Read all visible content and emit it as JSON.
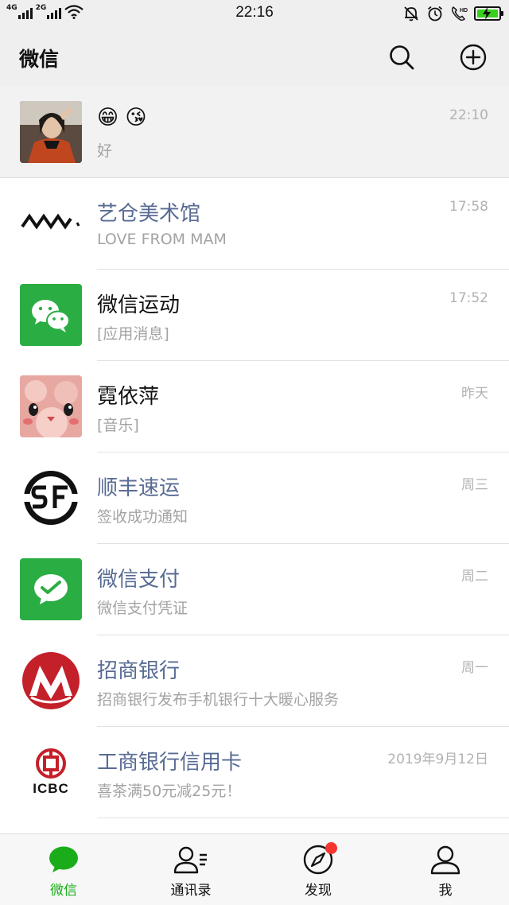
{
  "status_bar": {
    "network1": "4G",
    "network2": "2G",
    "time": "22:16",
    "battery_color": "#39d11f"
  },
  "header": {
    "title": "微信",
    "search_icon": "search-icon",
    "add_icon": "plus-circle-icon"
  },
  "chats": [
    {
      "name": "😁 😘",
      "preview": "好",
      "time": "22:10",
      "pinned": true,
      "avatar": "photo-avatar"
    },
    {
      "name": "艺仓美术馆",
      "preview": "LOVE FROM MAM",
      "time": "17:58",
      "official": true,
      "avatar": "museum-logo"
    },
    {
      "name": "微信运动",
      "preview": "[应用消息]",
      "time": "17:52",
      "avatar": "wechat-sport-icon"
    },
    {
      "name": "霓依萍",
      "preview": "[音乐]",
      "time": "昨天",
      "avatar": "cartoon-avatar"
    },
    {
      "name": "顺丰速运",
      "preview": "签收成功通知",
      "time": "周三",
      "official": true,
      "avatar": "sf-express-logo"
    },
    {
      "name": "微信支付",
      "preview": "微信支付凭证",
      "time": "周二",
      "official": true,
      "avatar": "wechat-pay-icon"
    },
    {
      "name": "招商银行",
      "preview": "招商银行发布手机银行十大暖心服务",
      "time": "周一",
      "official": true,
      "avatar": "cmb-logo"
    },
    {
      "name": "工商银行信用卡",
      "preview": "喜茶满50元减25元！",
      "time": "2019年9月12日",
      "official": true,
      "avatar": "icbc-logo",
      "avatar_text": "ICBC"
    }
  ],
  "tabs": [
    {
      "label": "微信",
      "icon": "chat-bubble-icon",
      "active": true
    },
    {
      "label": "通讯录",
      "icon": "contacts-icon"
    },
    {
      "label": "发现",
      "icon": "compass-icon",
      "badge": true
    },
    {
      "label": "我",
      "icon": "person-icon"
    }
  ],
  "colors": {
    "accent": "#1aad19",
    "official_name": "#586b94",
    "badge": "#f43530"
  }
}
